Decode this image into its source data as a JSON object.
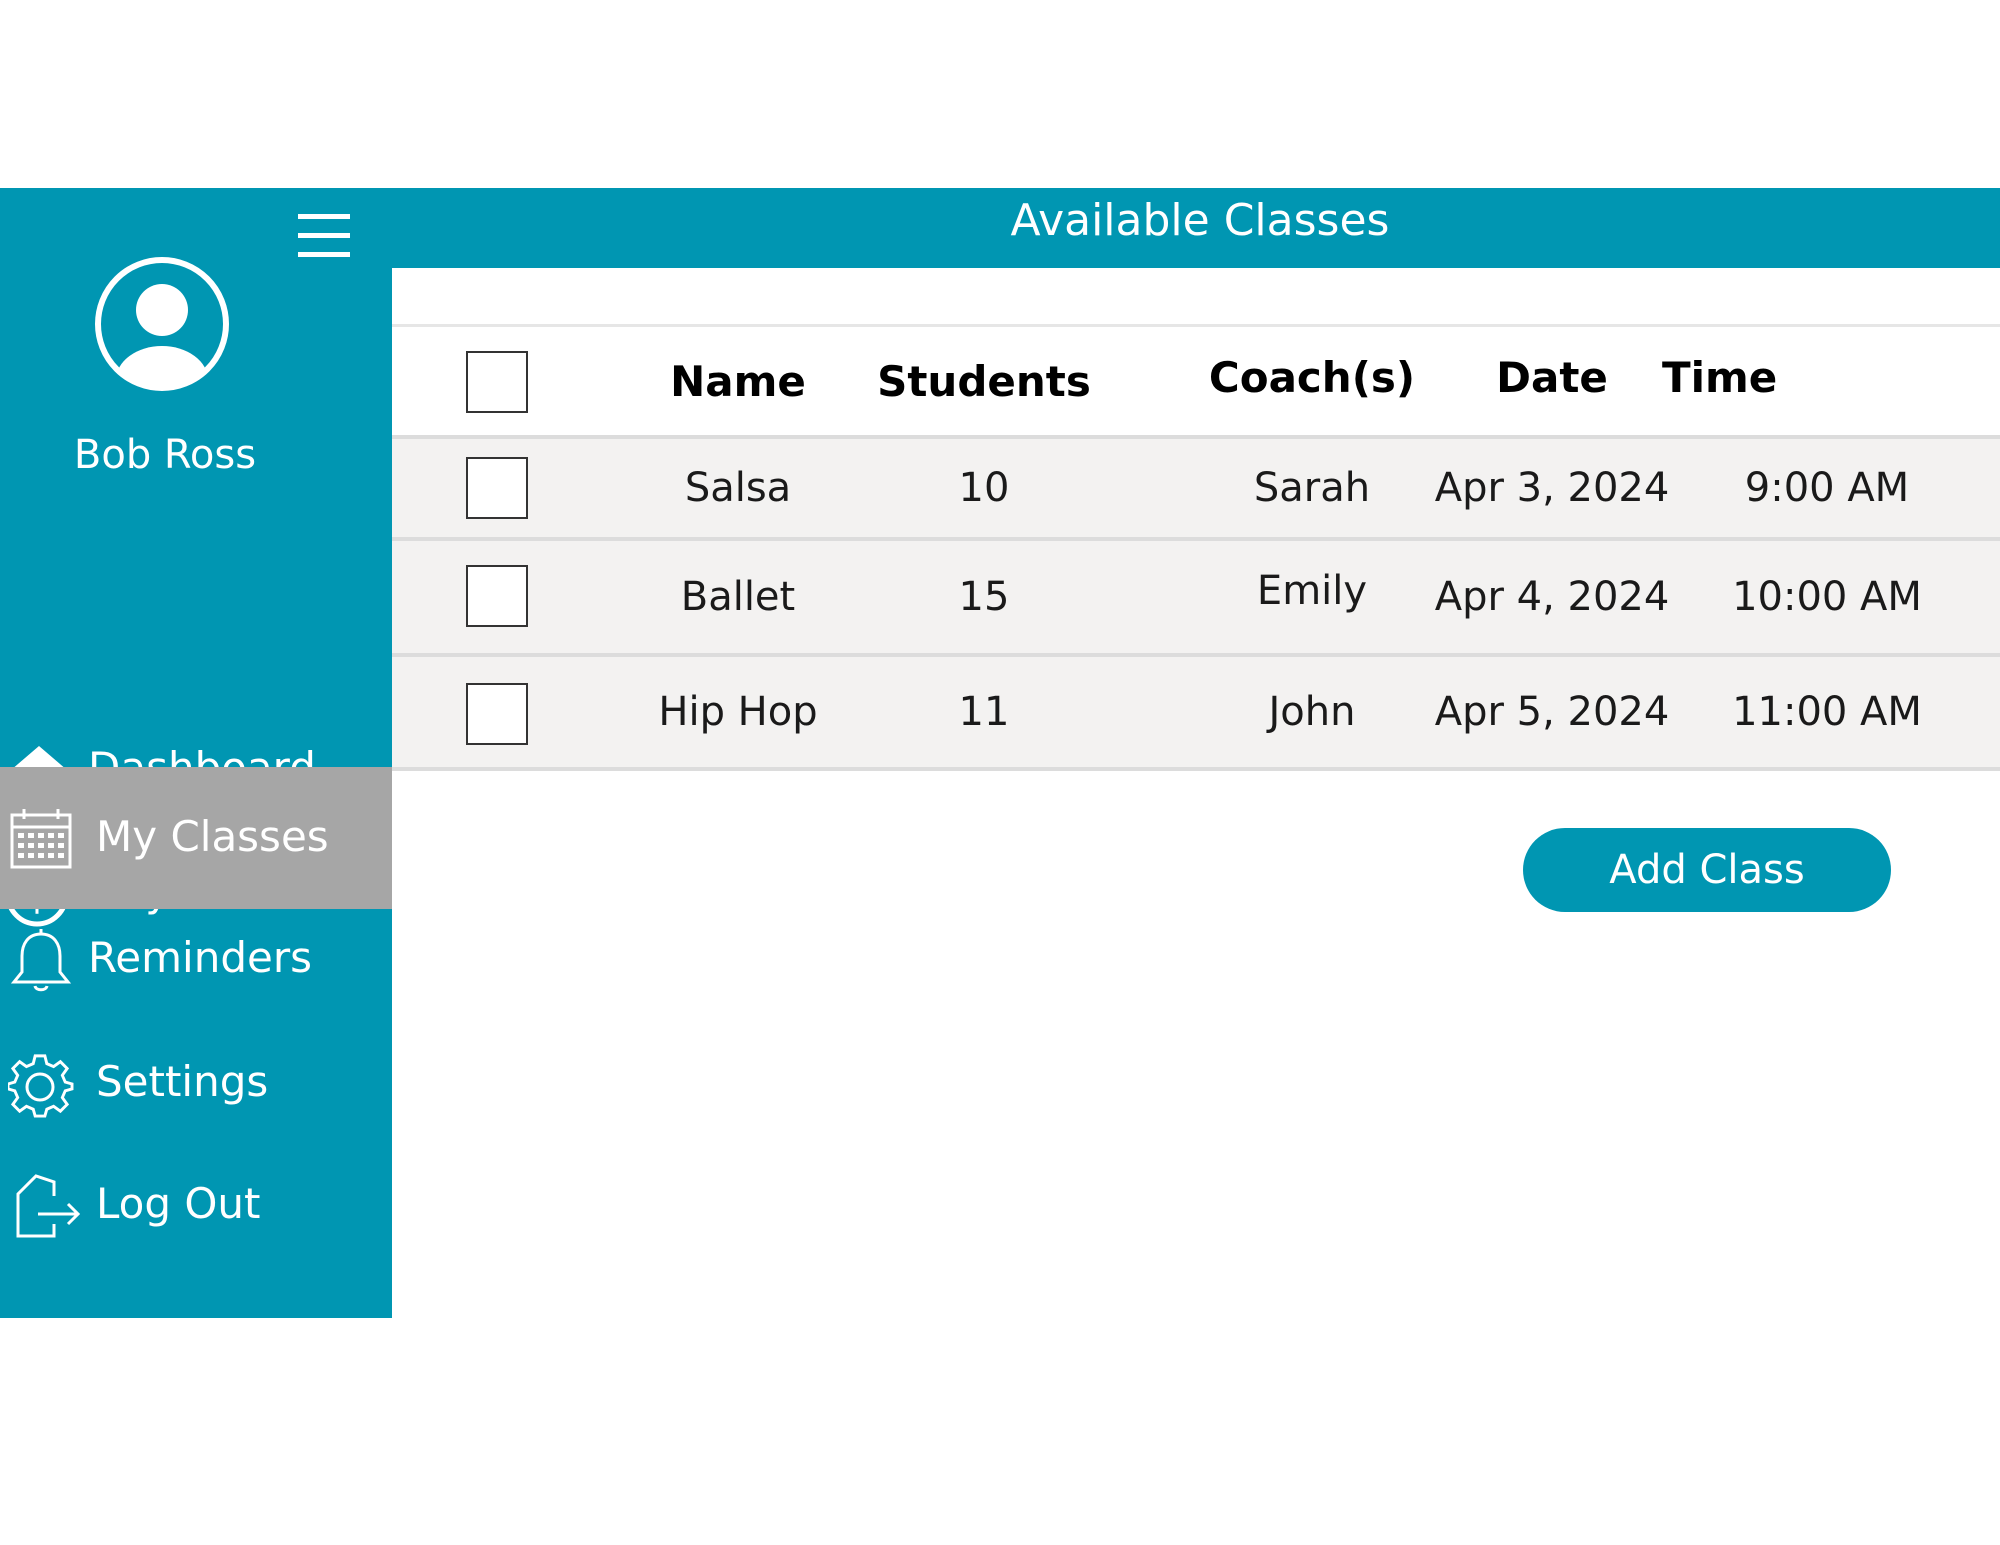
{
  "user": {
    "name": "Bob Ross",
    "avatar_icon": "user-avatar-icon"
  },
  "menu_icon": "hamburger-menu-icon",
  "colors": {
    "primary": "#0096b2",
    "active_nav": "#a6a6a6",
    "row_bg": "#f3f2f1"
  },
  "sidebar": {
    "items": [
      {
        "label": "Dashboard",
        "icon": "home-icon",
        "active": false
      },
      {
        "label": "Payments",
        "icon": "dollar-circle-icon",
        "active": false
      },
      {
        "label": "My Classes",
        "icon": "calendar-icon",
        "active": true
      },
      {
        "label": "Reminders",
        "icon": "bell-icon",
        "active": false
      },
      {
        "label": "Settings",
        "icon": "gear-icon",
        "active": false
      },
      {
        "label": "Log Out",
        "icon": "logout-icon",
        "active": false
      }
    ]
  },
  "main": {
    "title": "Available Classes",
    "table": {
      "columns": [
        "Name",
        "Students",
        "Coach(s)",
        "Date",
        "Time"
      ],
      "rows": [
        {
          "name": "Salsa",
          "students": "10",
          "coach": "Sarah",
          "date": "Apr 3, 2024",
          "time": "9:00 AM"
        },
        {
          "name": "Ballet",
          "students": "15",
          "coach": "Emily",
          "date": "Apr 4, 2024",
          "time": "10:00 AM"
        },
        {
          "name": "Hip Hop",
          "students": "11",
          "coach": "John",
          "date": "Apr 5, 2024",
          "time": "11:00 AM"
        }
      ]
    },
    "add_button_label": "Add Class"
  }
}
